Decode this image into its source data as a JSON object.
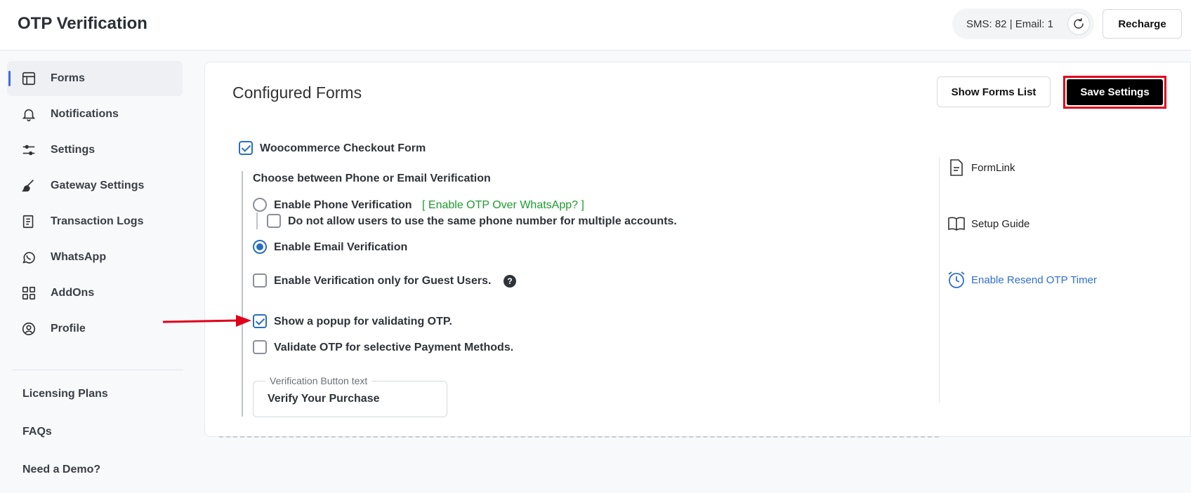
{
  "header": {
    "title": "OTP Verification",
    "credits": "SMS: 82 | Email: 1",
    "recharge_label": "Recharge"
  },
  "sidebar": {
    "items": [
      {
        "label": "Forms",
        "icon": "forms-icon"
      },
      {
        "label": "Notifications",
        "icon": "bell-icon"
      },
      {
        "label": "Settings",
        "icon": "sliders-icon"
      },
      {
        "label": "Gateway Settings",
        "icon": "brush-icon"
      },
      {
        "label": "Transaction Logs",
        "icon": "receipt-icon"
      },
      {
        "label": "WhatsApp",
        "icon": "whatsapp-icon"
      },
      {
        "label": "AddOns",
        "icon": "grid-icon"
      },
      {
        "label": "Profile",
        "icon": "user-circle-icon"
      }
    ],
    "links": [
      "Licensing Plans",
      "FAQs",
      "Need a Demo?"
    ]
  },
  "main": {
    "title": "Configured Forms",
    "show_forms_list_label": "Show Forms List",
    "save_settings_label": "Save Settings",
    "form_name": "Woocommerce Checkout Form",
    "choose_label": "Choose between Phone or Email Verification",
    "phone_label": "Enable Phone Verification",
    "whatsapp_link": "[ Enable OTP Over WhatsApp? ]",
    "same_phone_label": "Do not allow users to use the same phone number for multiple accounts.",
    "email_label": "Enable Email Verification",
    "guest_label": "Enable Verification only for Guest Users.",
    "popup_label": "Show a popup for validating OTP.",
    "payment_label": "Validate OTP for selective Payment Methods.",
    "button_text_legend": "Verification Button text",
    "button_text_value": "Verify Your Purchase",
    "states": {
      "form_checked": true,
      "phone_selected": false,
      "same_phone_checked": false,
      "email_selected": true,
      "guest_checked": false,
      "popup_checked": true,
      "payment_checked": false
    }
  },
  "side_links": [
    {
      "label": "FormLink",
      "icon": "document-icon"
    },
    {
      "label": "Setup Guide",
      "icon": "book-icon"
    },
    {
      "label": "Enable Resend OTP Timer",
      "icon": "alarm-clock-icon"
    }
  ],
  "colors": {
    "accent_blue": "#2a6fbd",
    "whatsapp_green": "#1e9b2e",
    "highlight_red": "#e0001b"
  }
}
